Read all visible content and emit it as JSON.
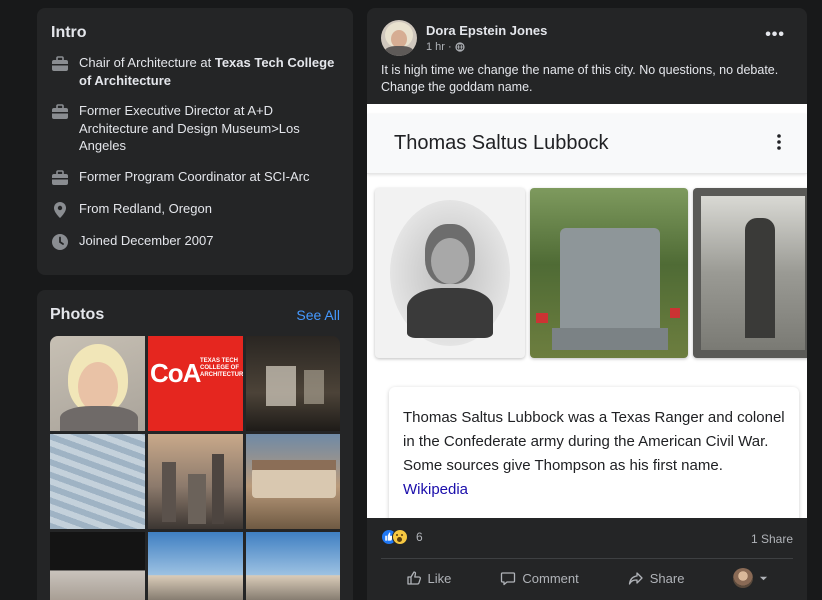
{
  "intro": {
    "title": "Intro",
    "items": [
      {
        "icon": "briefcase-icon",
        "prefix": "Chair of Architecture at ",
        "strong": "Texas Tech College of Architecture"
      },
      {
        "icon": "briefcase-icon",
        "prefix": "Former Executive Director at A+D Architecture and Design Museum>Los Angeles",
        "strong": ""
      },
      {
        "icon": "briefcase-icon",
        "prefix": "Former Program Coordinator at SCI-Arc",
        "strong": ""
      },
      {
        "icon": "location-pin-icon",
        "prefix": "From Redland, Oregon",
        "strong": ""
      },
      {
        "icon": "clock-icon",
        "prefix": "Joined December 2007",
        "strong": ""
      }
    ]
  },
  "photos": {
    "title": "Photos",
    "see_all": "See All",
    "coa_logo": "CoA",
    "coa_text": "TEXAS TECH COLLEGE OF ARCHITECTURE"
  },
  "post": {
    "author": "Dora Epstein Jones",
    "time": "1 hr",
    "more": "•••",
    "text": "It is high time we change the name of this city. No questions, no debate. Change the goddam name.",
    "embed": {
      "title": "Thomas Saltus Lubbock",
      "description": "Thomas Saltus Lubbock was a Texas Ranger and colonel in the Confederate army during the American Civil War. Some sources give Thompson as his first name.",
      "source": "Wikipedia"
    },
    "reaction_count": "6",
    "shares": "1 Share",
    "actions": {
      "like": "Like",
      "comment": "Comment",
      "share": "Share"
    }
  },
  "colors": {
    "background": "#18191a",
    "card": "#242526",
    "link": "#4599ff",
    "text": "#e4e6eb",
    "muted": "#b0b3b8"
  }
}
